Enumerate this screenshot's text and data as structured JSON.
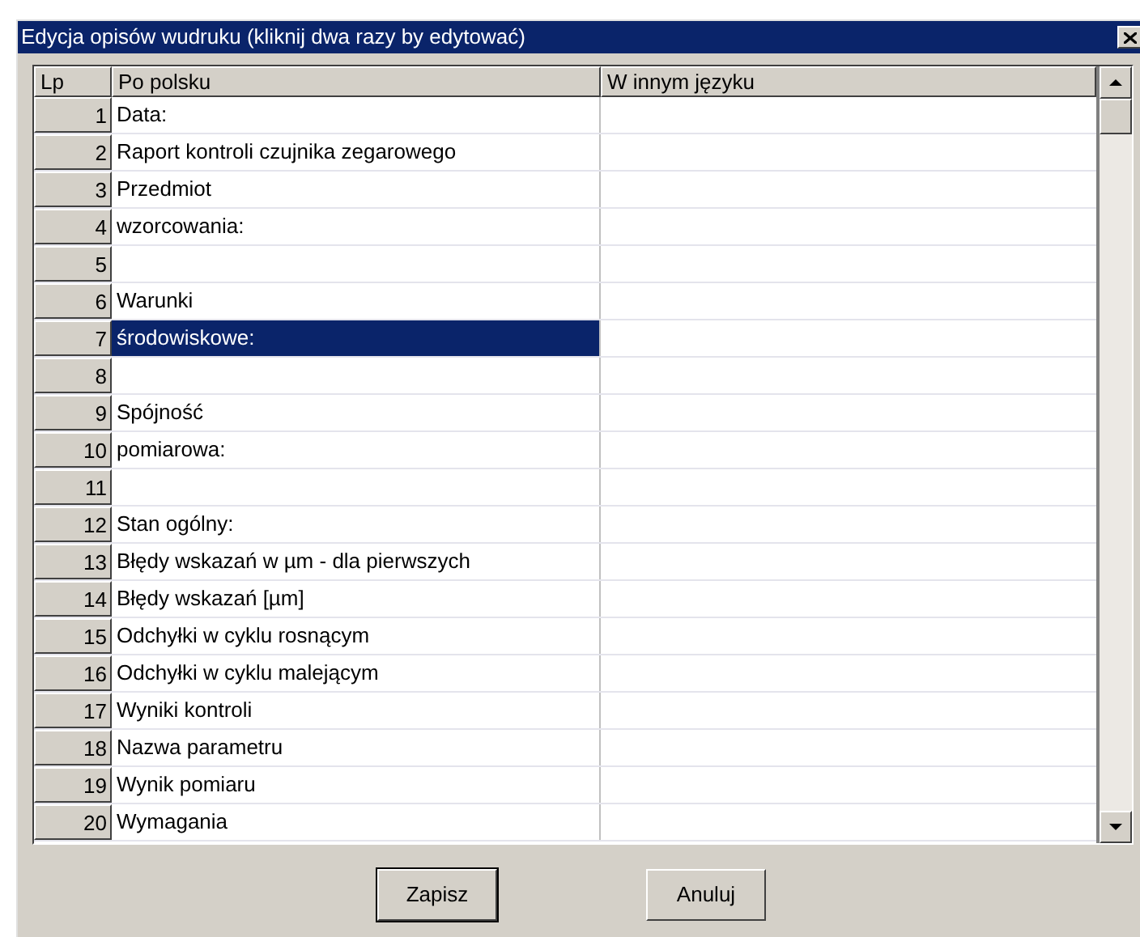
{
  "window": {
    "title": "Edycja opisów wudruku (kliknij dwa razy by edytować)"
  },
  "table": {
    "columns": [
      "Lp",
      "Po polsku",
      "W innym języku"
    ],
    "rows": [
      {
        "lp": "1",
        "text": "Data:",
        "selected": false
      },
      {
        "lp": "2",
        "text": "Raport kontroli czujnika zegarowego",
        "selected": false
      },
      {
        "lp": "3",
        "text": "Przedmiot",
        "selected": false
      },
      {
        "lp": "4",
        "text": "wzorcowania:",
        "selected": false
      },
      {
        "lp": "5",
        "selected": false
      },
      {
        "lp": "6",
        "text": "Warunki",
        "selected": false
      },
      {
        "lp": "7",
        "text": "środowiskowe:",
        "selected": true
      },
      {
        "lp": "8",
        "selected": false
      },
      {
        "lp": "9",
        "text": "Spójność",
        "selected": false
      },
      {
        "lp": "10",
        "text": "pomiarowa:",
        "selected": false
      },
      {
        "lp": "11",
        "selected": false
      },
      {
        "lp": "12",
        "text": "Stan ogólny:",
        "selected": false
      },
      {
        "lp": "13",
        "text": "Błędy wskazań w µm - dla pierwszych",
        "selected": false
      },
      {
        "lp": "14",
        "text": "Błędy wskazań [µm]",
        "selected": false
      },
      {
        "lp": "15",
        "text": "Odchyłki w cyklu rosnącym",
        "selected": false
      },
      {
        "lp": "16",
        "text": "Odchyłki w cyklu malejącym",
        "selected": false
      },
      {
        "lp": "17",
        "text": "Wyniki kontroli",
        "selected": false
      },
      {
        "lp": "18",
        "text": "Nazwa parametru",
        "selected": false
      },
      {
        "lp": "19",
        "text": "Wynik pomiaru",
        "selected": false
      },
      {
        "lp": "20",
        "text": "Wymagania",
        "selected": false
      }
    ]
  },
  "buttons": [
    "Zapisz",
    "Anuluj"
  ]
}
